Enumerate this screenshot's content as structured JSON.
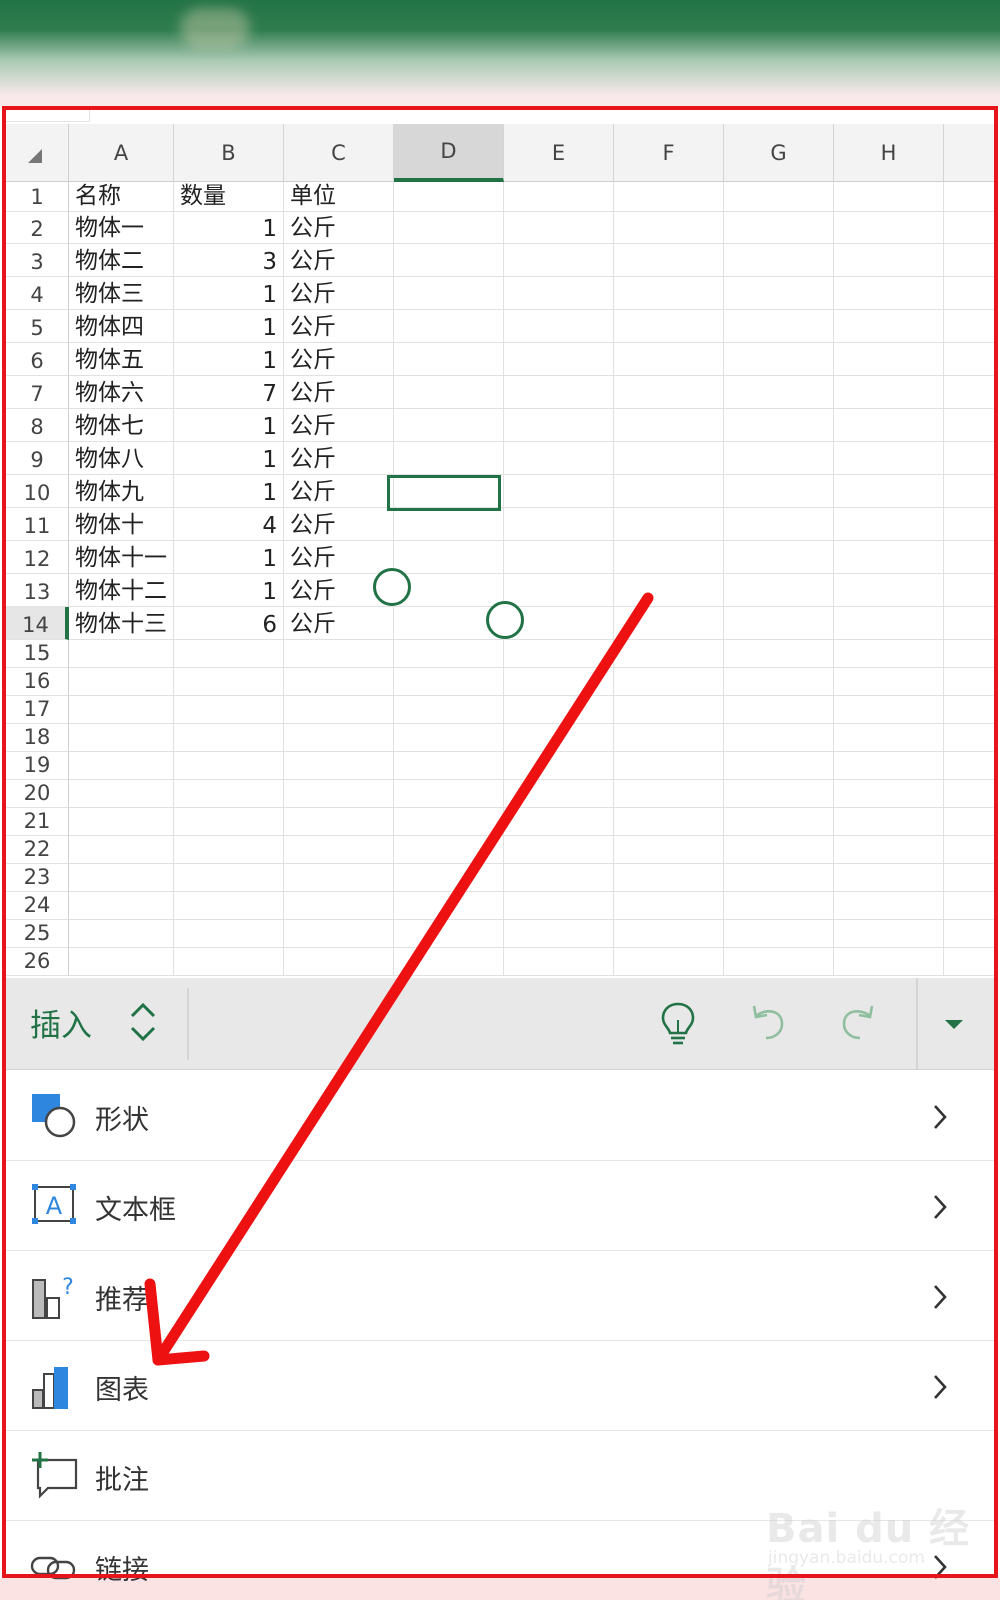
{
  "sheet": {
    "columns": [
      "A",
      "B",
      "C",
      "D",
      "E",
      "F",
      "G",
      "H"
    ],
    "selected_column": "D",
    "selected_row": 14,
    "row_numbers": [
      "1",
      "2",
      "3",
      "4",
      "5",
      "6",
      "7",
      "8",
      "9",
      "10",
      "11",
      "12",
      "13",
      "14",
      "15",
      "16",
      "17",
      "18",
      "19",
      "20",
      "21",
      "22",
      "23",
      "24",
      "25",
      "26"
    ],
    "rows": [
      {
        "a": "名称",
        "b": "数量",
        "c": "单位"
      },
      {
        "a": "物体一",
        "b": "1",
        "c": "公斤"
      },
      {
        "a": "物体二",
        "b": "3",
        "c": "公斤"
      },
      {
        "a": "物体三",
        "b": "1",
        "c": "公斤"
      },
      {
        "a": "物体四",
        "b": "1",
        "c": "公斤"
      },
      {
        "a": "物体五",
        "b": "1",
        "c": "公斤"
      },
      {
        "a": "物体六",
        "b": "7",
        "c": "公斤"
      },
      {
        "a": "物体七",
        "b": "1",
        "c": "公斤"
      },
      {
        "a": "物体八",
        "b": "1",
        "c": "公斤"
      },
      {
        "a": "物体九",
        "b": "1",
        "c": "公斤"
      },
      {
        "a": "物体十",
        "b": "4",
        "c": "公斤"
      },
      {
        "a": "物体十一",
        "b": "1",
        "c": "公斤"
      },
      {
        "a": "物体十二",
        "b": "1",
        "c": "公斤"
      },
      {
        "a": "物体十三",
        "b": "6",
        "c": "公斤"
      }
    ]
  },
  "toolbar": {
    "tab_label": "插入",
    "icons": [
      "updown-icon",
      "lightbulb-icon",
      "undo-icon",
      "redo-icon",
      "dropdown-icon"
    ]
  },
  "menu": {
    "items": [
      {
        "label": "形状",
        "icon": "shapes-icon"
      },
      {
        "label": "文本框",
        "icon": "textbox-icon"
      },
      {
        "label": "推荐",
        "icon": "recommended-chart-icon"
      },
      {
        "label": "图表",
        "icon": "chart-icon"
      },
      {
        "label": "批注",
        "icon": "comment-icon"
      },
      {
        "label": "链接",
        "icon": "link-icon"
      }
    ]
  },
  "textbox_icon_letter": "A",
  "recommended_icon_mark": "?",
  "watermark": {
    "text": "Bai du 经验",
    "url": "jingyan.baidu.com"
  },
  "colors": {
    "accent": "#217346",
    "highlight": "#e8141b",
    "icon_blue": "#2e86de"
  }
}
